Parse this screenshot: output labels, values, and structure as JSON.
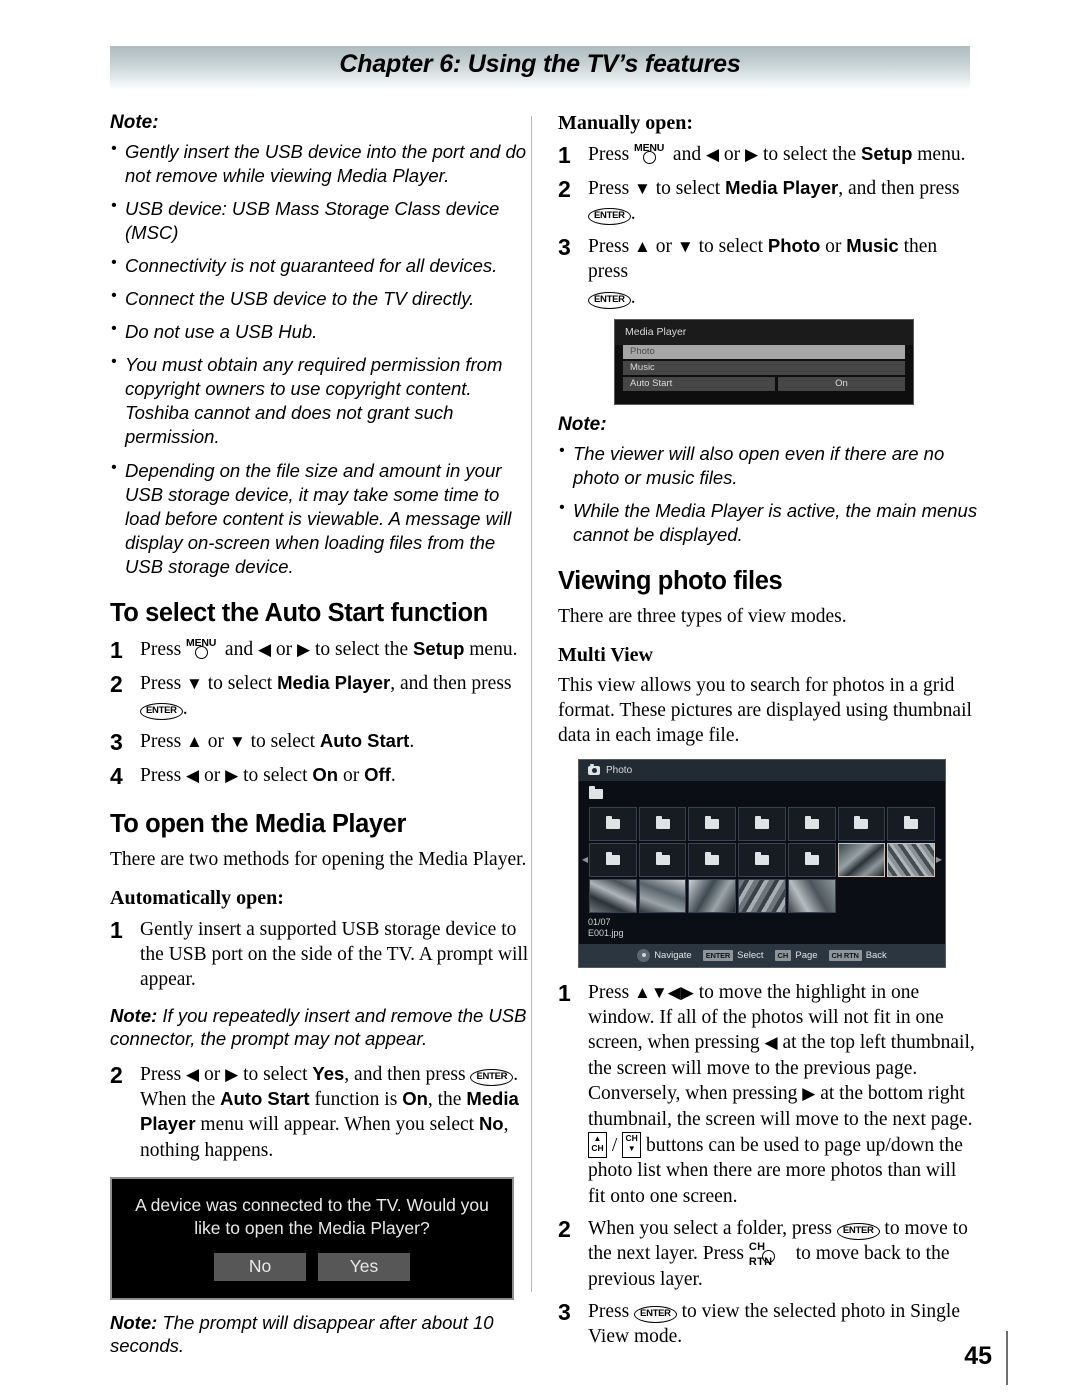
{
  "header": {
    "chapter_title": "Chapter 6: Using the TV’s features"
  },
  "footer": {
    "page_number": "45"
  },
  "left_column": {
    "note_heading": "Note:",
    "note_items": [
      "Gently insert the USB device into the port and do not remove while viewing Media Player.",
      "USB device: USB Mass Storage Class device (MSC)",
      "Connectivity is not guaranteed for all devices.",
      "Connect the USB device to the TV directly.",
      "Do not use a USB Hub.",
      "You must obtain any required permission from copyright owners to use copyright content. Toshiba cannot and does not grant such permission.",
      "Depending on the file size and amount in your USB storage device, it may take some time to load before content is viewable. A message will display on-screen when loading files from the USB storage device."
    ],
    "auto_start_heading": "To select the Auto Start function",
    "auto_start_steps": [
      {
        "n": "1",
        "pre": "Press ",
        "key": "MENU",
        "mid1": " and ",
        "a1": "◀",
        "mid2": " or ",
        "a2": "▶",
        "mid3": " to select the ",
        "bold1": "Setup",
        "post": " menu."
      },
      {
        "n": "2",
        "pre": "Press ",
        "a1": "▼",
        "mid1": " to select ",
        "bold1": "Media Player",
        "mid2": ", and then press ",
        "key": "ENTER",
        "post": "."
      },
      {
        "n": "3",
        "pre": "Press ",
        "a1": "▲",
        "mid1": " or ",
        "a2": "▼",
        "mid2": " to select ",
        "bold1": "Auto Start",
        "post": "."
      },
      {
        "n": "4",
        "pre": "Press ",
        "a1": "◀",
        "mid1": " or ",
        "a2": "▶",
        "mid2": " to select ",
        "bold1": "On",
        "mid3": " or ",
        "bold2": "Off",
        "post": "."
      }
    ],
    "open_mp_heading": "To open the Media Player",
    "open_mp_intro": "There are two methods for opening the Media Player.",
    "auto_open_heading": "Automatically open:",
    "auto_open_step1_n": "1",
    "auto_open_step1": "Gently insert a supported USB storage device to the USB port on the side of the TV. A prompt will appear.",
    "note_insert_label": "Note:",
    "note_insert_text": " If you repeatedly insert and remove the USB connector, the prompt may not appear.",
    "auto_open_step2_n": "2",
    "auto_open_step2": {
      "pre": "Press ",
      "a1": "◀",
      "mid1": " or ",
      "a2": "▶",
      "mid2": " to select ",
      "bold1": "Yes",
      "mid3": ", and then press ",
      "key": "ENTER",
      "mid4": ". When the ",
      "bold2": "Auto Start",
      "mid5": " function is ",
      "bold3": "On",
      "mid6": ", the ",
      "bold4": "Media Player",
      "mid7": " menu will appear. When you select ",
      "bold5": "No",
      "post": ", nothing happens."
    },
    "prompt_dialog": {
      "message": "A device was connected to the TV. Would you like to open the Media Player?",
      "button_no": "No",
      "button_yes": "Yes"
    },
    "note_prompt_label": "Note:",
    "note_prompt_text": " The prompt will disappear after about 10 seconds."
  },
  "right_column": {
    "manual_open_heading": "Manually open:",
    "manual_open_steps": [
      {
        "n": "1",
        "pre": "Press ",
        "key": "MENU",
        "mid1": " and ",
        "a1": "◀",
        "mid2": " or ",
        "a2": "▶",
        "mid3": " to select the ",
        "bold1": "Setup",
        "post": " menu."
      },
      {
        "n": "2",
        "pre": "Press ",
        "a1": "▼",
        "mid1": " to select ",
        "bold1": "Media Player",
        "mid2": ", and then press ",
        "key": "ENTER",
        "post": "."
      },
      {
        "n": "3",
        "pre": "Press ",
        "a1": "▲",
        "mid1": " or ",
        "a2": "▼",
        "mid2": " to select ",
        "bold1": "Photo",
        "mid3": " or ",
        "bold2": "Music",
        "mid4": " then press ",
        "key": "ENTER",
        "post": "."
      }
    ],
    "media_player_osd": {
      "title": "Media Player",
      "rows": [
        {
          "label": "Photo",
          "value": "",
          "state": "selected"
        },
        {
          "label": "Music",
          "value": "",
          "state": "normal"
        },
        {
          "label": "Auto Start",
          "value": "On",
          "state": "split"
        }
      ]
    },
    "note_heading": "Note:",
    "note_items": [
      "The viewer will also open even if there are no photo or music files.",
      "While the Media Player is active, the main menus cannot be displayed."
    ],
    "viewing_heading": "Viewing photo files",
    "viewing_intro": "There are three types of view modes.",
    "multi_view_heading": "Multi View",
    "multi_view_intro": "This view allows you to search for photos in a grid format. These pictures are displayed using thumbnail data in each image file.",
    "photo_osd": {
      "title": "Photo",
      "counter": "01/07",
      "filename": "E001.jpg",
      "nav": [
        {
          "icon": "dpad",
          "label": "Navigate"
        },
        {
          "icon": "ENTER",
          "label": "Select"
        },
        {
          "icon": "CH",
          "label": "Page"
        },
        {
          "icon": "CH RTN",
          "label": "Back"
        }
      ],
      "grid": [
        [
          "folder",
          "folder",
          "folder",
          "folder",
          "folder",
          "folder",
          "folder"
        ],
        [
          "folder",
          "folder",
          "folder",
          "folder",
          "folder",
          "photo",
          "photo"
        ],
        [
          "photo",
          "photo",
          "photo",
          "photo",
          "photo",
          "empty",
          "empty"
        ]
      ]
    },
    "multi_steps": [
      {
        "n": "1",
        "t1": "Press ",
        "arrows": "▲▼◀▶",
        "t2": " to move the highlight in one window. If all of the photos will not fit in one screen, when pressing ",
        "a1": "◀",
        "t3": " at the top left thumbnail, the screen will move to the previous page. Conversely, when pressing ",
        "a2": "▶",
        "t4": " at the bottom right thumbnail, the screen will move to the next page. ",
        "t5": " buttons can be used to page up/down the photo list when there are more photos than will fit onto one screen."
      },
      {
        "n": "2",
        "t1": "When you select a folder, press ",
        "key1": "ENTER",
        "t2": " to move to the next layer. Press ",
        "key2": "CH RTN",
        "t3": " to move back to the previous layer."
      },
      {
        "n": "3",
        "t1": "Press ",
        "key1": "ENTER",
        "t2": " to view the selected photo in Single View mode."
      }
    ]
  }
}
